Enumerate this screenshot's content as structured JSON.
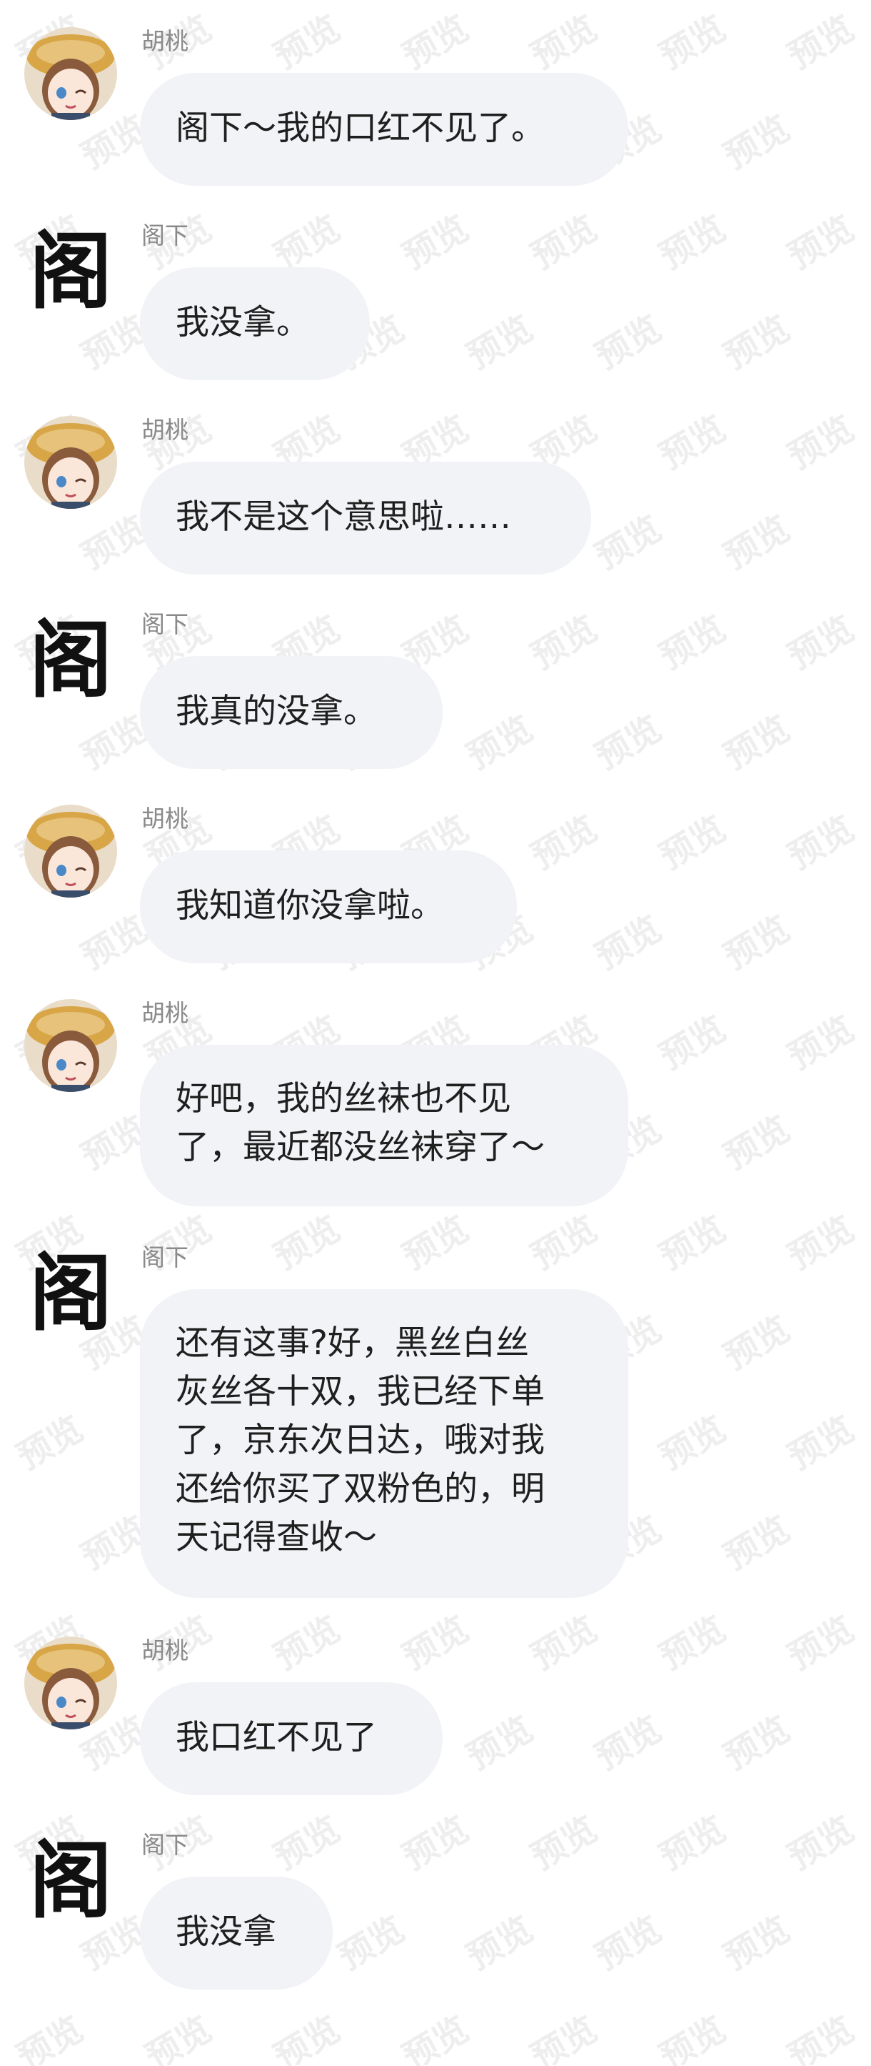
{
  "watermark_text": "预览",
  "contacts": {
    "hutao": {
      "name": "胡桃",
      "avatar_icon": "anime-girl-avatar-icon"
    },
    "gexia": {
      "name": "阁下",
      "avatar_glyph": "阁"
    }
  },
  "messages": [
    {
      "sender": "胡桃",
      "text": "阁下～我的口红不见了。"
    },
    {
      "sender": "阁下",
      "text": "我没拿。"
    },
    {
      "sender": "胡桃",
      "text": "我不是这个意思啦……"
    },
    {
      "sender": "阁下",
      "text": "我真的没拿。"
    },
    {
      "sender": "胡桃",
      "text": "我知道你没拿啦。"
    },
    {
      "sender": "胡桃",
      "text": "好吧，我的丝袜也不见\n了，最近都没丝袜穿了～"
    },
    {
      "sender": "阁下",
      "text": "还有这事?好，黑丝白丝\n灰丝各十双，我已经下单\n了，京东次日达，哦对我\n还给你买了双粉色的，明\n天记得查收～"
    },
    {
      "sender": "胡桃",
      "text": "我口红不见了"
    },
    {
      "sender": "阁下",
      "text": "我没拿"
    }
  ]
}
